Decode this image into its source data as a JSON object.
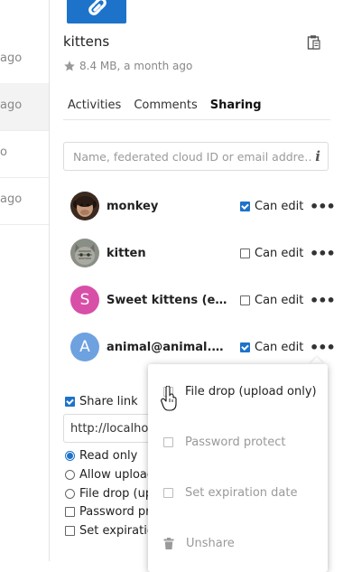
{
  "file_list": {
    "rows": [
      {
        "time": "ago",
        "selected": false
      },
      {
        "time": "ago",
        "selected": true
      },
      {
        "time": "o",
        "selected": false
      },
      {
        "time": "ago",
        "selected": false
      }
    ]
  },
  "file": {
    "name": "kittens",
    "meta": "8.4 MB, a month ago"
  },
  "tabs": [
    {
      "label": "Activities",
      "active": false
    },
    {
      "label": "Comments",
      "active": false
    },
    {
      "label": "Sharing",
      "active": true
    }
  ],
  "search": {
    "placeholder": "Name, federated cloud ID or email addre…",
    "value": ""
  },
  "shares": [
    {
      "name": "monkey",
      "avatar": "monkey-photo",
      "permission_label": "Can edit",
      "can_edit": true
    },
    {
      "name": "kitten",
      "avatar": "kitten-photo",
      "permission_label": "Can edit",
      "can_edit": false
    },
    {
      "name": "Sweet kittens (email)",
      "avatar_letter": "S",
      "avatar_color": "#d84fa8",
      "permission_label": "Can edit",
      "can_edit": false
    },
    {
      "name": "animal@animal.co…",
      "avatar_letter": "A",
      "avatar_color": "#6ea1e0",
      "permission_label": "Can edit",
      "can_edit": true
    }
  ],
  "share_link": {
    "label": "Share link",
    "checked": true,
    "url": "http://localhos",
    "options": [
      {
        "label": "Read only",
        "type": "radio",
        "selected": true
      },
      {
        "label": "Allow upload",
        "type": "radio",
        "selected": false
      },
      {
        "label": "File drop (upl",
        "type": "radio",
        "selected": false
      },
      {
        "label": "Password pro",
        "type": "checkbox",
        "checked": false
      },
      {
        "label": "Set expiration",
        "type": "checkbox",
        "checked": false
      }
    ]
  },
  "popover_menu": {
    "items": [
      {
        "label": "File drop (upload only)",
        "type": "checkbox",
        "checked": false,
        "muted": false
      },
      {
        "label": "Password protect",
        "type": "checkbox",
        "checked": false,
        "muted": true
      },
      {
        "label": "Set expiration date",
        "type": "checkbox",
        "checked": false,
        "muted": true
      },
      {
        "label": "Unshare",
        "type": "action",
        "icon": "trash-icon",
        "muted": true
      }
    ]
  },
  "colors": {
    "accent": "#1d73c9",
    "muted_text": "#888888"
  }
}
